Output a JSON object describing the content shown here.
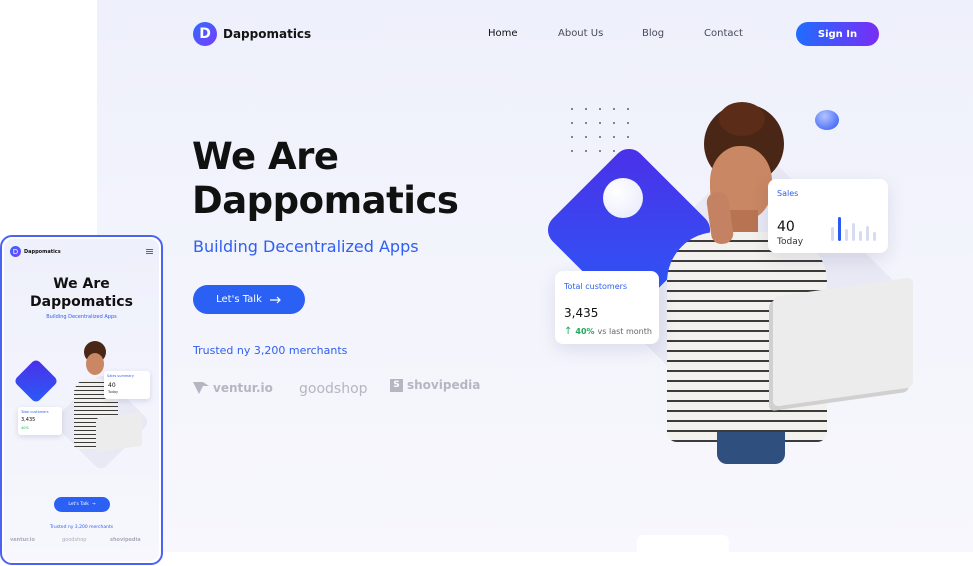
{
  "desktop": {
    "logo": {
      "mark": "D",
      "name": "Dappomatics"
    },
    "nav": {
      "links": [
        {
          "label": "Home",
          "active": true
        },
        {
          "label": "About Us"
        },
        {
          "label": "Blog"
        },
        {
          "label": "Contact"
        }
      ],
      "signin_label": "Sign In"
    },
    "hero": {
      "title_line1": "We Are",
      "title_line2": "Dappomatics",
      "subtitle": "Building Decentralized Apps",
      "cta_label": "Let's Talk",
      "trusted_text": "Trusted ny 3,200 merchants",
      "brands": [
        {
          "name": "ventur.io",
          "icon": "v-logo-icon"
        },
        {
          "name": "goodshop"
        },
        {
          "name": "shovipedia",
          "icon": "s-square-icon"
        }
      ]
    },
    "cards": {
      "sales": {
        "label": "Sales",
        "value": "40",
        "sub": "Today"
      },
      "customers": {
        "label": "Total customers",
        "value": "3,435",
        "change": "40%",
        "change_note": "vs last month"
      }
    }
  },
  "mobile": {
    "logo": {
      "mark": "D",
      "name": "Dappomatics"
    },
    "hero": {
      "title_line1": "We Are",
      "title_line2": "Dappomatics",
      "subtitle": "Building Decentralized Apps",
      "cta_label": "Let's Talk",
      "trusted_text": "Trusted ny 3,200 merchants",
      "brands": [
        "ventur.io",
        "goodshop",
        "shovipedia"
      ]
    },
    "cards": {
      "sales": {
        "label": "Sales summary",
        "value": "40",
        "sub": "Today"
      },
      "customers": {
        "label": "Total customers",
        "value": "3,435",
        "change": "40%"
      }
    }
  },
  "colors": {
    "accent_blue": "#2b60f5",
    "accent_purple": "#7a2df5",
    "positive_green": "#22a95a",
    "title_text": "#111111"
  }
}
